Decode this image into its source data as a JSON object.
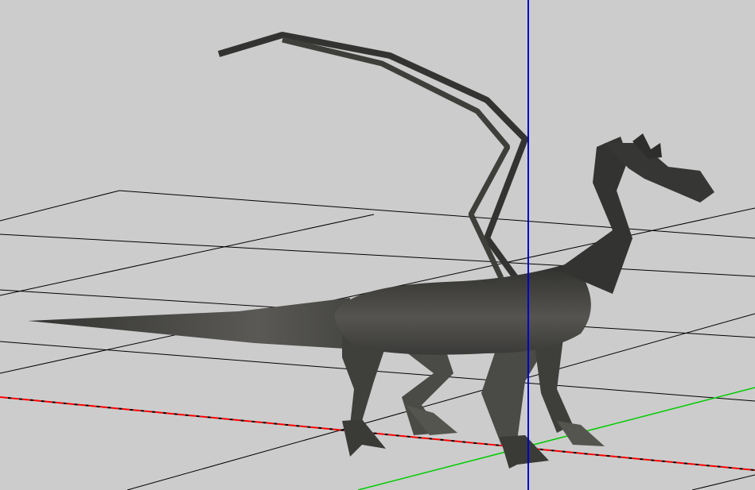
{
  "viewport": {
    "background_color": "#cccccc",
    "grid_color": "#000000",
    "axis_x_color": "#ff0000",
    "axis_y_color": "#00cc00",
    "axis_z_color": "#0000cc",
    "model_color": "#3c3c3a"
  }
}
